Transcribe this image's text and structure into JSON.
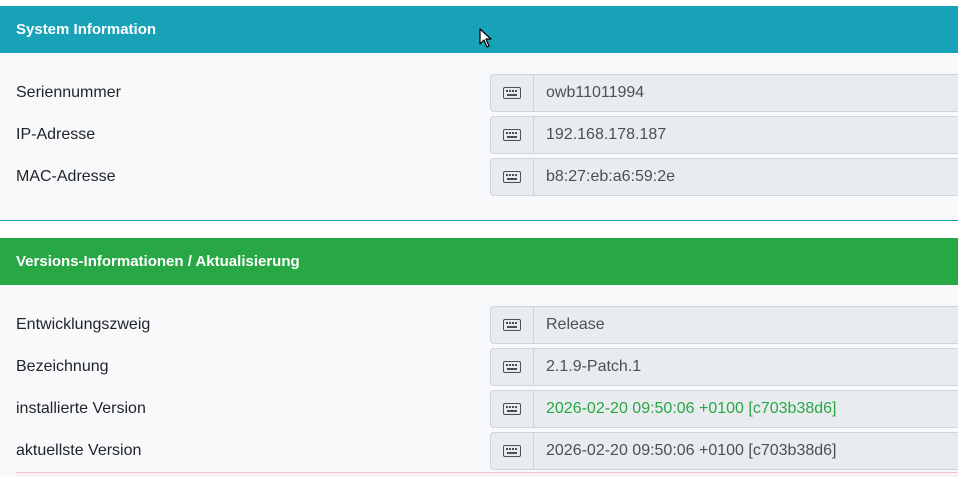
{
  "system_card": {
    "title": "System Information",
    "rows": [
      {
        "label": "Seriennummer",
        "value": "owb11011994"
      },
      {
        "label": "IP-Adresse",
        "value": "192.168.178.187"
      },
      {
        "label": "MAC-Adresse",
        "value": "b8:27:eb:a6:59:2e"
      }
    ]
  },
  "version_card": {
    "title": "Versions-Informationen / Aktualisierung",
    "rows": [
      {
        "label": "Entwicklungszweig",
        "value": "Release"
      },
      {
        "label": "Bezeichnung",
        "value": "2.1.9-Patch.1"
      },
      {
        "label": "installierte Version",
        "value": "2026-02-20 09:50:06 +0100 [c703b38d6]",
        "status_color": "#28a745"
      },
      {
        "label": "aktuellste Version",
        "value": "2026-02-20 09:50:06 +0100 [c703b38d6]"
      }
    ]
  },
  "colors": {
    "system_header": "#17a2b8",
    "version_header": "#28a745",
    "readonly_field": "#e9ecef"
  },
  "icons": {
    "field_addon": "keyboard-icon",
    "pointer": "mouse-cursor-icon"
  }
}
